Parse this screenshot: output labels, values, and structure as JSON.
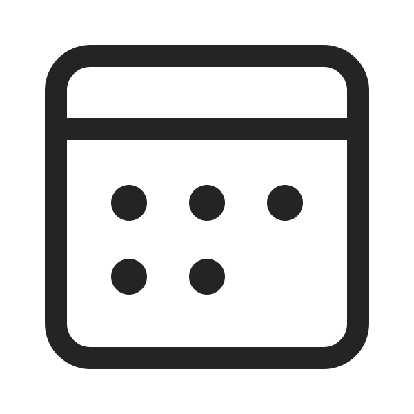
{
  "icon": {
    "name": "calendar-icon",
    "stroke_color": "#242424",
    "background_color": "#ffffff",
    "date_dots": {
      "rows": [
        3,
        2
      ]
    }
  }
}
